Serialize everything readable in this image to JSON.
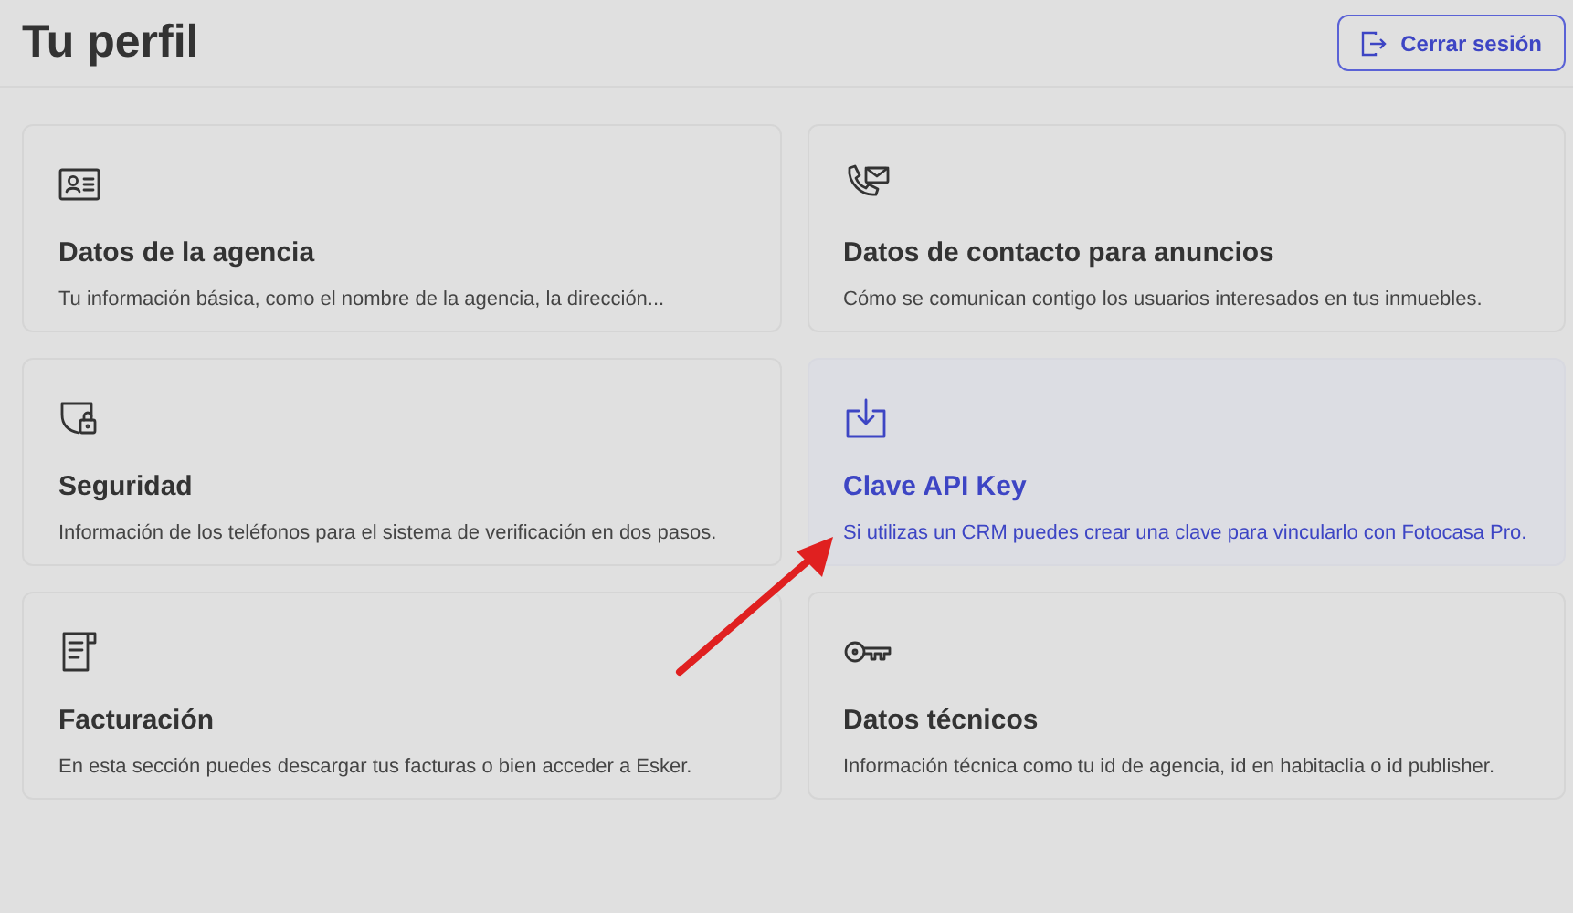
{
  "header": {
    "title": "Tu perfil",
    "logout_button": "Cerrar sesión"
  },
  "cards": [
    {
      "kind": "agency",
      "title": "Datos de la agencia",
      "description": "Tu información básica, como el nombre de la agencia, la dirección...",
      "selected": false
    },
    {
      "kind": "contact",
      "title": "Datos de contacto para anuncios",
      "description": "Cómo se comunican contigo los usuarios interesados en tus inmuebles.",
      "selected": false
    },
    {
      "kind": "security",
      "title": "Seguridad",
      "description": "Información de los teléfonos para el sistema de verificación en dos pasos.",
      "selected": false
    },
    {
      "kind": "apikey",
      "title": "Clave API Key",
      "description": "Si utilizas un CRM puedes crear una clave para vincularlo con Fotocasa Pro.",
      "selected": true
    },
    {
      "kind": "billing",
      "title": "Facturación",
      "description": "En esta sección puedes descargar tus facturas o bien acceder a Esker.",
      "selected": false
    },
    {
      "kind": "technical",
      "title": "Datos técnicos",
      "description": "Información técnica como tu id de agencia, id en habitaclia o id publisher.",
      "selected": false
    }
  ]
}
